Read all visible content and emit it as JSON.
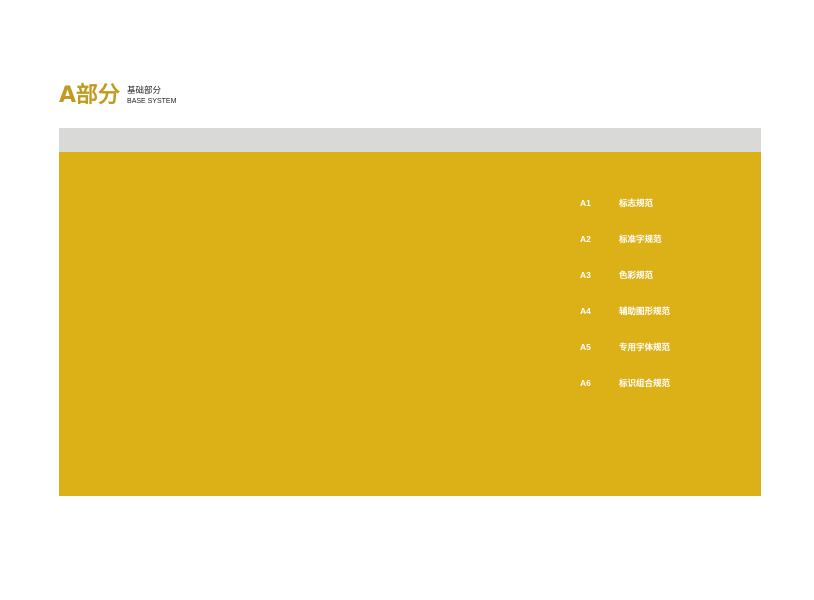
{
  "header": {
    "title": "A部分",
    "subtitle_cn": "基础部分",
    "subtitle_en": "BASE SYSTEM"
  },
  "colors": {
    "accent": "#c29a1f",
    "panel": "#dcb017",
    "band": "#d9d9d8",
    "text_on_panel": "#ffffff"
  },
  "toc": {
    "items": [
      {
        "code": "A1",
        "label": "标志规范"
      },
      {
        "code": "A2",
        "label": "标准字规范"
      },
      {
        "code": "A3",
        "label": "色彩规范"
      },
      {
        "code": "A4",
        "label": "辅助图形规范"
      },
      {
        "code": "A5",
        "label": "专用字体规范"
      },
      {
        "code": "A6",
        "label": "标识组合规范"
      }
    ]
  }
}
